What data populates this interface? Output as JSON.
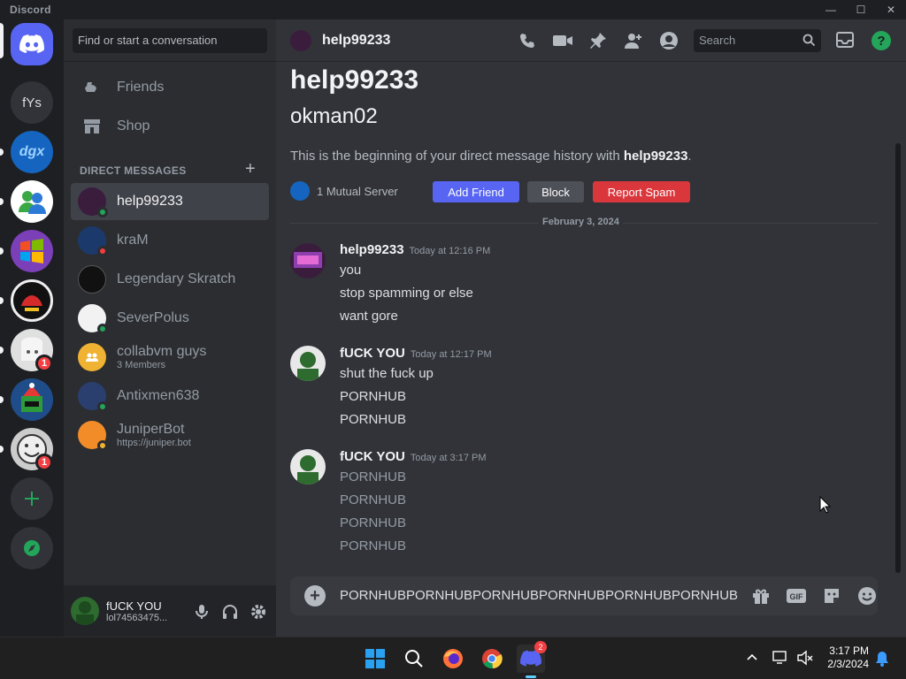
{
  "window": {
    "title": "Discord",
    "controls": [
      "minimize",
      "maximize",
      "close"
    ]
  },
  "servers": [
    {
      "id": "home",
      "icon": "discord-logo",
      "color": "#5865f2"
    },
    {
      "id": "fYs",
      "label": "fYs",
      "color": "#313338"
    },
    {
      "id": "dgx",
      "label": "dgx",
      "color": "#1565c0"
    },
    {
      "id": "msn",
      "icon": "messenger-people",
      "color": "#ffffff"
    },
    {
      "id": "win7",
      "icon": "windows-logo",
      "color": "#7b3fb8"
    },
    {
      "id": "mask",
      "icon": "red-mask",
      "color": "#111111"
    },
    {
      "id": "anime",
      "icon": "anime-face",
      "color": "#e0e0e0",
      "badge": "1"
    },
    {
      "id": "santa",
      "icon": "santa-monster",
      "color": "#1f4d8a"
    },
    {
      "id": "smile",
      "icon": "smile-face",
      "color": "#cccccc",
      "badge": "1"
    },
    {
      "id": "add",
      "icon": "plus-icon"
    },
    {
      "id": "discover",
      "icon": "compass-icon"
    }
  ],
  "dm_sidebar": {
    "search_placeholder": "Find or start a conversation",
    "friends_label": "Friends",
    "shop_label": "Shop",
    "dm_heading": "DIRECT MESSAGES",
    "dms": [
      {
        "name": "help99233",
        "status": "online",
        "status_color": "#23a55a",
        "avatar_color": "#3a1d3d",
        "active": true
      },
      {
        "name": "kraM",
        "status": "dnd",
        "status_color": "#f23f43",
        "avatar_color": "#1b3a6b"
      },
      {
        "name": "Legendary Skratch",
        "status": "offline",
        "avatar_color": "#111111"
      },
      {
        "name": "SeverPolus",
        "status": "online",
        "status_color": "#23a55a",
        "avatar_color": "#f2f2f2"
      },
      {
        "name": "collabvm guys",
        "sub": "3 Members",
        "avatar_color": "#f0b232",
        "group": true
      },
      {
        "name": "Antixmen638",
        "status": "online",
        "status_color": "#23a55a",
        "avatar_color": "#2a3f6e"
      },
      {
        "name": "JuniperBot",
        "sub": "https://juniper.bot",
        "status": "idle",
        "status_color": "#f0b232",
        "avatar_color": "#f28c28"
      }
    ]
  },
  "user_panel": {
    "name": "fUCK YOU",
    "tag": "lol74563475...",
    "avatar_color": "#2d6b2f"
  },
  "header": {
    "name": "help99233",
    "search_placeholder": "Search"
  },
  "intro": {
    "name": "help99233",
    "username": "okman02",
    "text_prefix": "This is the beginning of your direct message history with ",
    "text_name": "help99233",
    "text_suffix": ".",
    "mutual": "1 Mutual Server",
    "add_friend": "Add Friend",
    "block": "Block",
    "report_spam": "Report Spam"
  },
  "date_divider": "February 3, 2024",
  "messages": [
    {
      "author": "help99233",
      "time": "Today at 12:16 PM",
      "avatar_color": "#3a1d3d",
      "lines": [
        "you",
        "stop spamming or else",
        "want gore"
      ],
      "pending": false
    },
    {
      "author": "fUCK YOU",
      "time": "Today at 12:17 PM",
      "avatar_color": "#2d6b2f",
      "lines": [
        "shut the fuck up",
        "PORNHUB",
        "PORNHUB"
      ],
      "pending": false
    },
    {
      "author": "fUCK YOU",
      "time": "Today at 3:17 PM",
      "avatar_color": "#2d6b2f",
      "lines": [
        "PORNHUB",
        "PORNHUB",
        "PORNHUB",
        "PORNHUB"
      ],
      "pending": true
    }
  ],
  "composer": {
    "value": "PORNHUBPORNHUBPORNHUBPORNHUBPORNHUBPORNHUB"
  },
  "taskbar": {
    "apps": [
      "start-icon",
      "search-icon",
      "firefox-icon",
      "chrome-icon",
      "discord-icon"
    ],
    "discord_badge": "2",
    "time": "3:17 PM",
    "date": "2/3/2024"
  },
  "colors": {
    "blurple": "#5865f2",
    "red": "#da373c",
    "grey_btn": "#4e5058"
  }
}
